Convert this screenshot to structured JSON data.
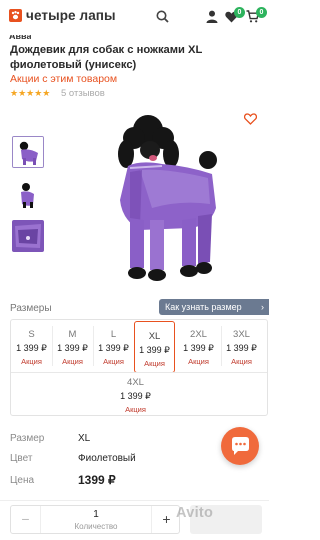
{
  "header": {
    "logo_text": "четыре лапы",
    "wishlist_count": "0",
    "cart_count": "0"
  },
  "product": {
    "brand": "Авва",
    "title": "Дождевик для собак с ножками XL фиолетовый (унисекс)",
    "promo_link": "Акции с этим товаром",
    "rating_stars": "★★★★★",
    "reviews": "5 отзывов"
  },
  "sizes": {
    "label": "Размеры",
    "guide_button": "Как узнать размер",
    "items": [
      {
        "size": "S",
        "price": "1 399 ₽",
        "badge": "Акция"
      },
      {
        "size": "M",
        "price": "1 399 ₽",
        "badge": "Акция"
      },
      {
        "size": "L",
        "price": "1 399 ₽",
        "badge": "Акция"
      },
      {
        "size": "XL",
        "price": "1 399 ₽",
        "badge": "Акция"
      },
      {
        "size": "2XL",
        "price": "1 399 ₽",
        "badge": "Акция"
      },
      {
        "size": "3XL",
        "price": "1 399 ₽",
        "badge": "Акция"
      },
      {
        "size": "4XL",
        "price": "1 399 ₽",
        "badge": "Акция"
      }
    ],
    "selected": "XL"
  },
  "details": {
    "size_label": "Размер",
    "size_value": "XL",
    "color_label": "Цвет",
    "color_value": "Фиолетовый",
    "price_label": "Цена",
    "price_value": "1399 ₽"
  },
  "quantity": {
    "minus": "−",
    "value": "1",
    "label": "Количество",
    "plus": "+"
  },
  "watermark": "Avito",
  "colors": {
    "accent": "#e8511f",
    "badge_green": "#2db35d",
    "guide_button": "#6b7a91",
    "promo_red": "#c0392b",
    "product_purple": "#8a5fc7"
  }
}
